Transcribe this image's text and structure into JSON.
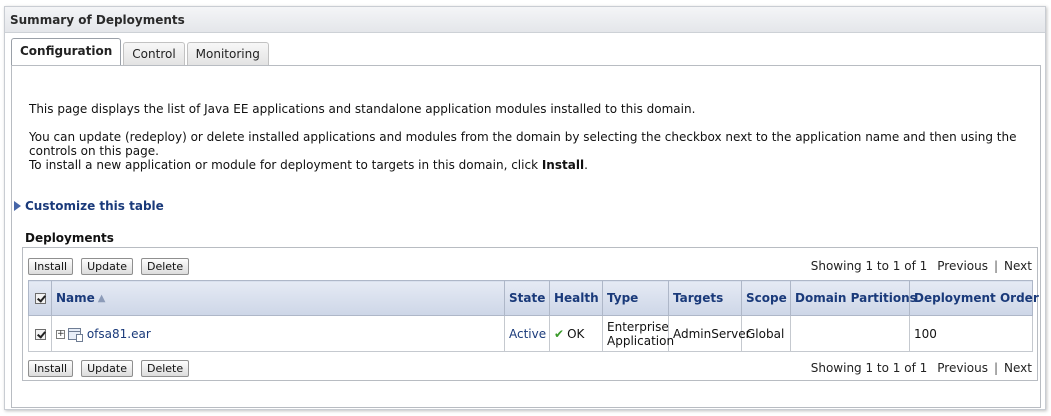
{
  "panel": {
    "title": "Summary of Deployments"
  },
  "tabs": [
    {
      "label": "Configuration",
      "active": true
    },
    {
      "label": "Control",
      "active": false
    },
    {
      "label": "Monitoring",
      "active": false
    }
  ],
  "intro": {
    "line1": "This page displays the list of Java EE applications and standalone application modules installed to this domain.",
    "line2": "You can update (redeploy) or delete installed applications and modules from the domain by selecting the checkbox next to the application name and then using the controls on this page.",
    "line3_prefix": "To install a new application or module for deployment to targets in this domain, click ",
    "line3_bold": "Install",
    "line3_suffix": "."
  },
  "customize": {
    "label": "Customize this table"
  },
  "table": {
    "title": "Deployments",
    "buttons": {
      "install": "Install",
      "update": "Update",
      "delete": "Delete"
    },
    "pager": {
      "showing": "Showing 1 to 1 of 1",
      "previous": "Previous",
      "separator": "|",
      "next": "Next"
    },
    "columns": {
      "name": "Name",
      "state": "State",
      "health": "Health",
      "type": "Type",
      "targets": "Targets",
      "scope": "Scope",
      "domain_partitions": "Domain Partitions",
      "deployment_order": "Deployment Order"
    },
    "rows": [
      {
        "checked": true,
        "name": "ofsa81.ear",
        "state": "Active",
        "health": "OK",
        "type_line1": "Enterprise",
        "type_line2": "Application",
        "targets": "AdminServer",
        "scope": "Global",
        "domain_partitions": "",
        "deployment_order": "100"
      }
    ]
  },
  "icons": {
    "customize": "triangle-right-icon",
    "sort": "sort-ascending-icon",
    "expand": "expand-plus-icon",
    "app": "application-archive-icon",
    "health": "checkmark-icon"
  },
  "colors": {
    "link": "#1a3a7a",
    "header_bg": "#cdd6e7",
    "ok_green": "#3a9a2a"
  }
}
